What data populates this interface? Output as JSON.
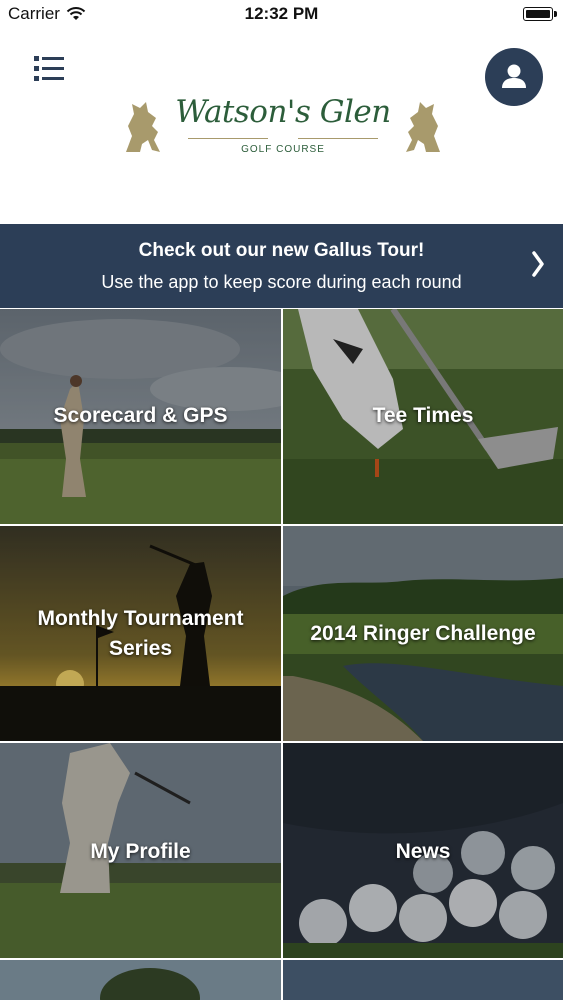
{
  "status_bar": {
    "carrier": "Carrier",
    "time": "12:32 PM"
  },
  "header": {
    "menu_icon": "menu-list-icon",
    "profile_icon": "user-icon",
    "logo_title": "Watson's Glen",
    "logo_subtitle": "GOLF COURSE"
  },
  "promo": {
    "title": "Check out our new Gallus Tour!",
    "subtitle": "Use the app to keep score during each round",
    "arrow_icon": "chevron-right-icon"
  },
  "tiles": [
    {
      "label": "Scorecard & GPS"
    },
    {
      "label": "Tee Times"
    },
    {
      "label_line1": "Monthly Tournament",
      "label_line2": "Series"
    },
    {
      "label": "2014 Ringer Challenge"
    },
    {
      "label": "My Profile"
    },
    {
      "label": "News"
    }
  ],
  "colors": {
    "navy": "#2c3e57",
    "logo_green": "#2c5d3a",
    "logo_gold": "#a89a6c"
  }
}
